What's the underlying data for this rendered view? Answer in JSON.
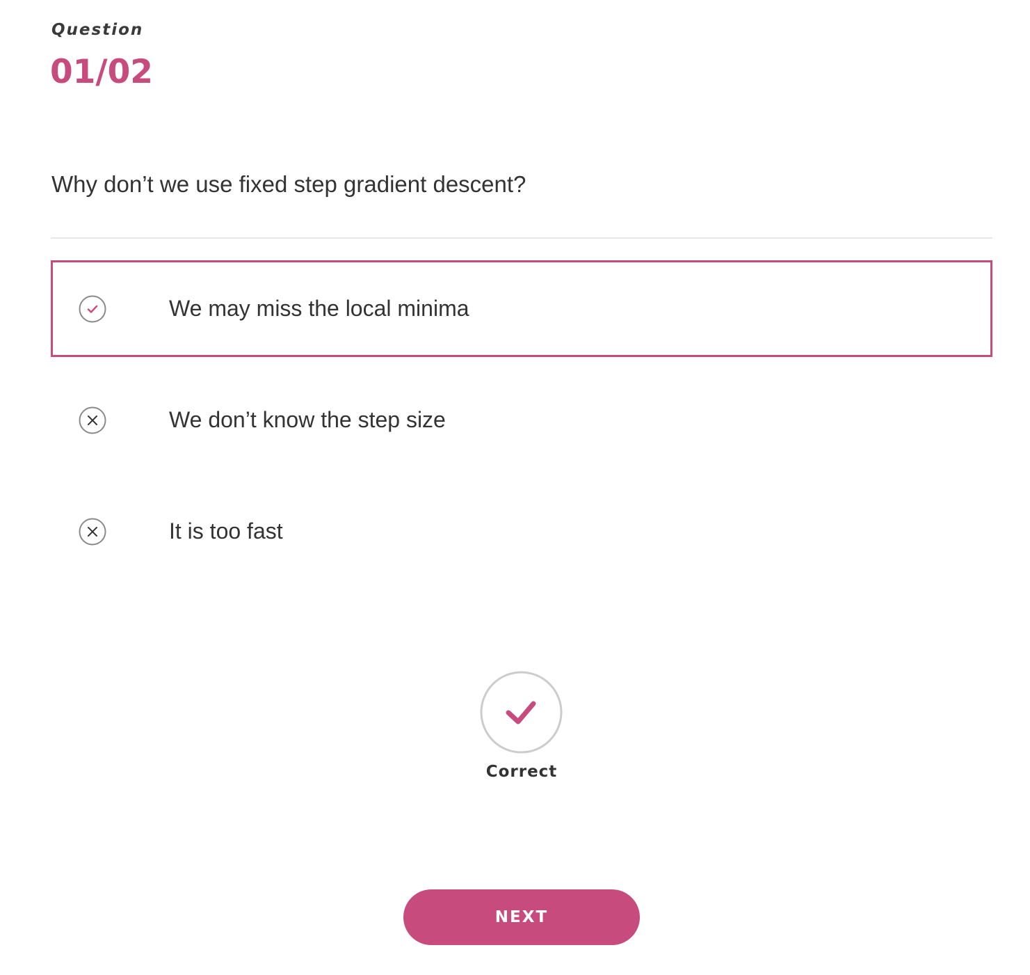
{
  "question": {
    "label": "Question",
    "counter": "01/02",
    "text": "Why don’t we use fixed step gradient descent?"
  },
  "options": [
    {
      "text": "We may miss the local minima",
      "icon": "check-circle-icon",
      "selected": true
    },
    {
      "text": "We don’t know the step size",
      "icon": "x-circle-icon",
      "selected": false
    },
    {
      "text": "It is too fast",
      "icon": "x-circle-icon",
      "selected": false
    }
  ],
  "result": {
    "icon": "check-icon",
    "label": "Correct"
  },
  "next_button": {
    "label": "NEXT"
  },
  "colors": {
    "accent": "#c84b7d",
    "text": "#333333",
    "divider": "#e6e6e6",
    "icon_border": "#8a8a8a"
  }
}
